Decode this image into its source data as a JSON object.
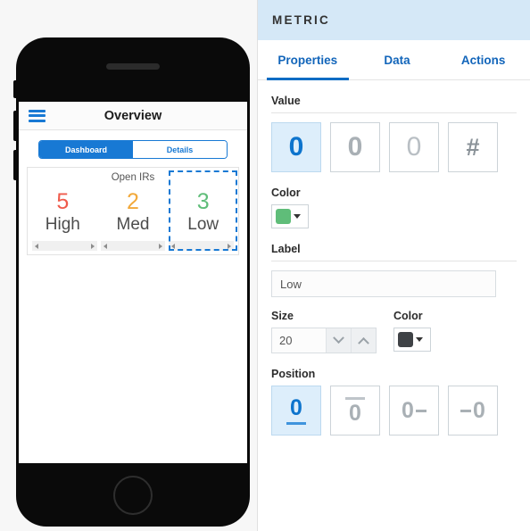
{
  "phone": {
    "navbar": {
      "menu_icon": "hamburger-icon",
      "title": "Overview"
    },
    "segmented_control": {
      "options": [
        {
          "label": "Dashboard",
          "active": true
        },
        {
          "label": "Details",
          "active": false
        }
      ]
    },
    "card": {
      "title": "Open IRs",
      "metrics": [
        {
          "value": "5",
          "label": "High",
          "color": "#ef5b4c",
          "selected": false
        },
        {
          "value": "2",
          "label": "Med",
          "color": "#f2a93b",
          "selected": false
        },
        {
          "value": "3",
          "label": "Low",
          "color": "#5fbd79",
          "selected": true
        }
      ]
    }
  },
  "panel": {
    "header": {
      "title": "METRIC"
    },
    "tabs": [
      {
        "label": "Properties",
        "active": true
      },
      {
        "label": "Data",
        "active": false
      },
      {
        "label": "Actions",
        "active": false
      }
    ],
    "value_section": {
      "label": "Value",
      "options": [
        {
          "glyph": "0",
          "name": "value-style-bold",
          "active": true
        },
        {
          "glyph": "0",
          "name": "value-style-regular",
          "active": false
        },
        {
          "glyph": "0",
          "name": "value-style-light",
          "active": false
        },
        {
          "glyph": "#",
          "name": "value-style-hash",
          "active": false
        }
      ],
      "color_label": "Color",
      "color": "#5fbd79"
    },
    "label_section": {
      "label": "Label",
      "text_value": "Low",
      "text_placeholder": "Label",
      "size_label": "Size",
      "size_value": "20",
      "color_label": "Color",
      "color": "#3f4246"
    },
    "position_section": {
      "label": "Position",
      "options": [
        {
          "glyph": "0",
          "variant": "under",
          "name": "position-below",
          "active": true
        },
        {
          "glyph": "0",
          "variant": "over",
          "name": "position-above",
          "active": false
        },
        {
          "glyph": "0",
          "variant": "right",
          "name": "position-right",
          "active": false
        },
        {
          "glyph": "0",
          "variant": "left",
          "name": "position-left",
          "active": false
        }
      ]
    }
  }
}
